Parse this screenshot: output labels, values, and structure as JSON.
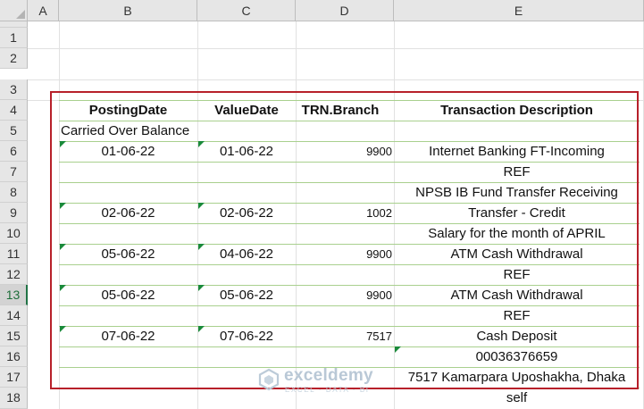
{
  "columns": [
    "A",
    "B",
    "C",
    "D",
    "E"
  ],
  "rows": [
    "1",
    "2",
    "3",
    "4",
    "5",
    "6",
    "7",
    "8",
    "9",
    "10",
    "11",
    "12",
    "13",
    "14",
    "15",
    "16",
    "17",
    "18"
  ],
  "selected_row": "13",
  "table": {
    "headers": {
      "posting_date": "PostingDate",
      "value_date": "ValueDate",
      "trn_branch": "TRN.Branch",
      "description": "Transaction Description"
    },
    "carried_over": "Carried Over Balance",
    "rows": [
      {
        "row": "6",
        "posting_date": "01-06-22",
        "value_date": "01-06-22",
        "trn_branch": "9900",
        "description": "Internet Banking FT-Incoming"
      },
      {
        "row": "7",
        "posting_date": "",
        "value_date": "",
        "trn_branch": "",
        "description": "REF"
      },
      {
        "row": "8",
        "posting_date": "",
        "value_date": "",
        "trn_branch": "",
        "description": "NPSB IB Fund Transfer Receiving"
      },
      {
        "row": "9",
        "posting_date": "02-06-22",
        "value_date": "02-06-22",
        "trn_branch": "1002",
        "description": "Transfer - Credit"
      },
      {
        "row": "10",
        "posting_date": "",
        "value_date": "",
        "trn_branch": "",
        "description": "Salary for the month of APRIL"
      },
      {
        "row": "11",
        "posting_date": "05-06-22",
        "value_date": "04-06-22",
        "trn_branch": "9900",
        "description": "ATM Cash Withdrawal"
      },
      {
        "row": "12",
        "posting_date": "",
        "value_date": "",
        "trn_branch": "",
        "description": "REF"
      },
      {
        "row": "13",
        "posting_date": "05-06-22",
        "value_date": "05-06-22",
        "trn_branch": "9900",
        "description": "ATM Cash Withdrawal"
      },
      {
        "row": "14",
        "posting_date": "",
        "value_date": "",
        "trn_branch": "",
        "description": "REF"
      },
      {
        "row": "15",
        "posting_date": "07-06-22",
        "value_date": "07-06-22",
        "trn_branch": "7517",
        "description": "Cash Deposit"
      },
      {
        "row": "16",
        "posting_date": "",
        "value_date": "",
        "trn_branch": "",
        "description": "00036376659"
      },
      {
        "row": "17",
        "posting_date": "",
        "value_date": "",
        "trn_branch": "",
        "description": "7517 Kamarpara Uposhakha, Dhaka"
      },
      {
        "row": "18",
        "posting_date": "",
        "value_date": "",
        "trn_branch": "",
        "description": "self"
      }
    ]
  },
  "watermark": {
    "name": "exceldemy",
    "tagline": "EXCEL · DATA · BI"
  },
  "colors": {
    "frame": "#b7202a",
    "table_border": "#a9d08e",
    "error_indicator": "#1a8a3a",
    "header_bg": "#e6e6e6"
  }
}
